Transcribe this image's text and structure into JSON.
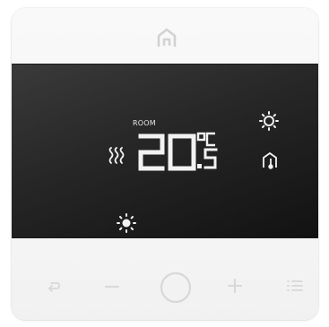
{
  "display": {
    "room_label": "ROOM",
    "temperature_integer": "20",
    "temperature_decimal": "5",
    "unit": "°C"
  },
  "icons": {
    "home": "home-icon",
    "sun_top": "sun-icon",
    "thermometer": "thermometer-icon",
    "heating": "heat-waves-icon",
    "sun_bottom": "sun-icon"
  },
  "controls": {
    "back": "back-icon",
    "minus": "minus-icon",
    "center": "power-circle-icon",
    "plus": "plus-icon",
    "menu": "menu-list-icon"
  },
  "colors": {
    "segment": "#f2f2f2",
    "screen_bg": "#262626",
    "body": "#f6f6f6",
    "control_glyph": "#d8d8d8"
  }
}
